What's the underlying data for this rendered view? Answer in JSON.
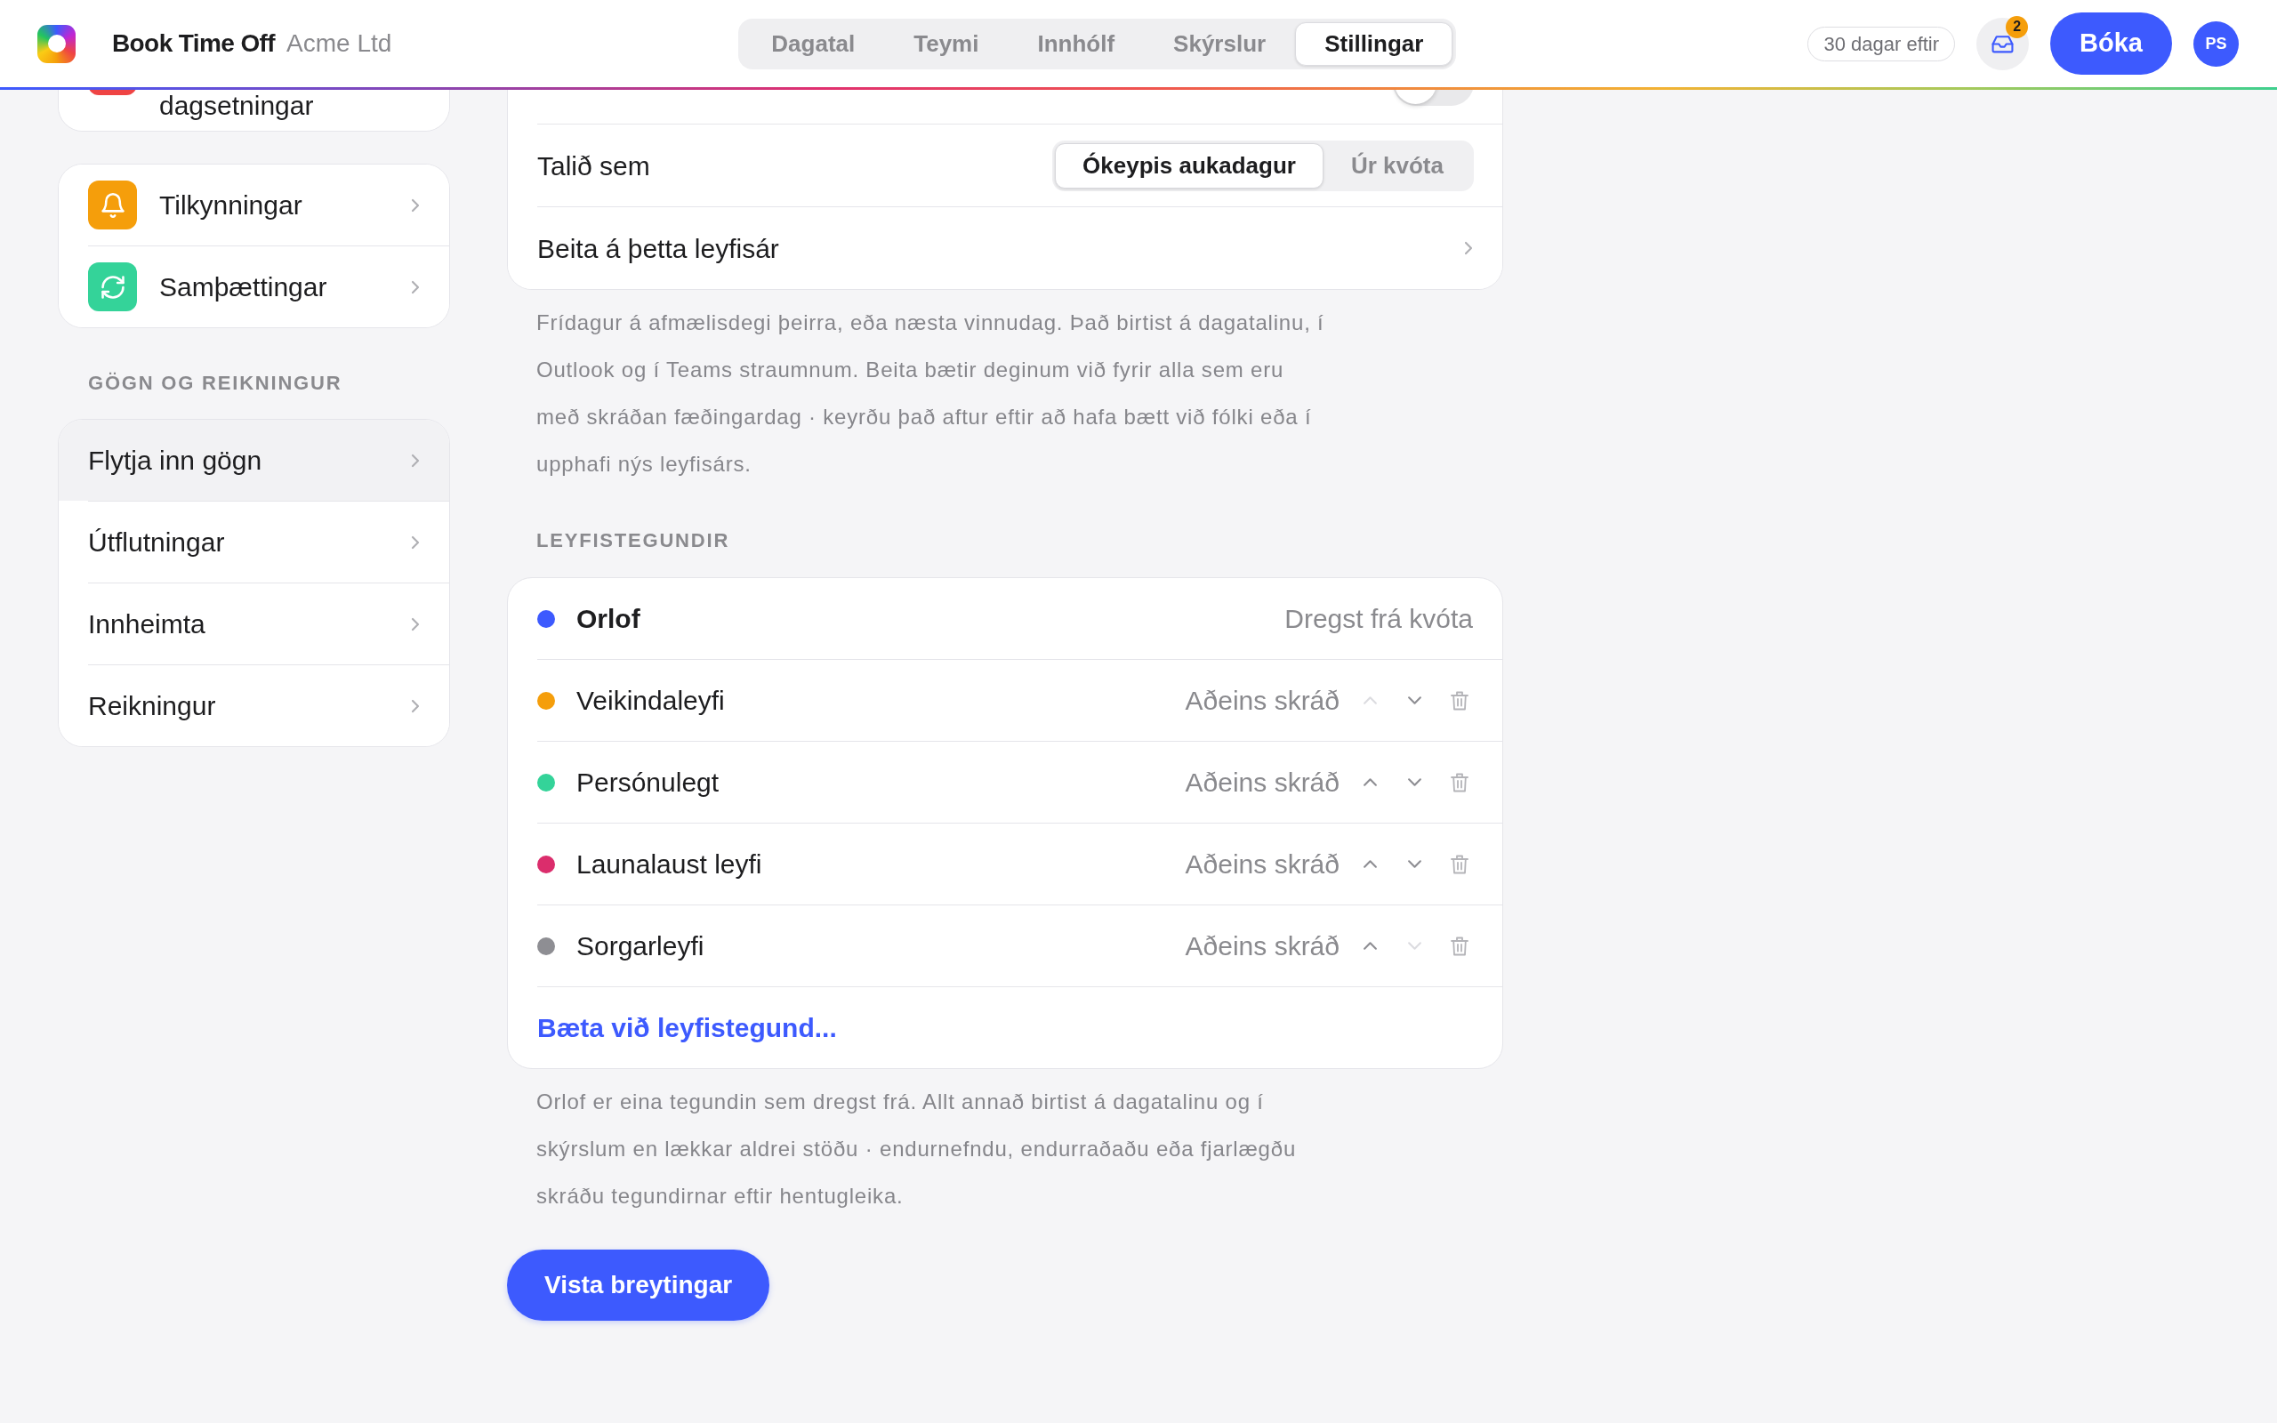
{
  "header": {
    "app_name": "Book Time Off",
    "org": "Acme Ltd",
    "tabs": [
      {
        "label": "Dagatal",
        "selected": false
      },
      {
        "label": "Teymi",
        "selected": false
      },
      {
        "label": "Innhólf",
        "selected": false
      },
      {
        "label": "Skýrslur",
        "selected": false
      },
      {
        "label": "Stillingar",
        "selected": true
      }
    ],
    "days_left": "30 dagar eftir",
    "inbox_badge": "2",
    "book_button": "Bóka",
    "avatar": "PS"
  },
  "sidebar": {
    "groups": [
      {
        "items": [
          {
            "label": "dagsetningar",
            "color": "#ef4444",
            "selected": false
          }
        ]
      },
      {
        "items": [
          {
            "label": "Tilkynningar",
            "color": "#f59e0b",
            "selected": false
          },
          {
            "label": "Samþættingar",
            "color": "#34d399",
            "selected": false
          }
        ]
      },
      {
        "heading": "GÖGN OG REIKNINGUR",
        "items": [
          {
            "label": "Flytja inn gögn",
            "selected": true
          },
          {
            "label": "Útflutningar",
            "selected": false
          },
          {
            "label": "Innheimta",
            "selected": false
          },
          {
            "label": "Reikningur",
            "selected": false
          }
        ]
      }
    ]
  },
  "birthday_leave": {
    "rows": [
      {
        "kind": "toggle",
        "on": false
      },
      {
        "kind": "choice",
        "label": "Talið sem",
        "options": [
          {
            "label": "Ókeypis aukadagur",
            "selected": true
          },
          {
            "label": "Úr kvóta",
            "selected": false
          }
        ]
      },
      {
        "kind": "link",
        "label": "Beita á þetta leyfisár"
      }
    ],
    "note": "Frídagur á afmælisdegi þeirra, eða næsta vinnudag. Það birtist á dagatalinu, í Outlook og í Teams straumnum. Beita bætir deginum við fyrir alla sem eru með skráðan fæðingardag · keyrðu það aftur eftir að hafa bætt við fólki eða í upphafi nýs leyfisárs."
  },
  "leave_types": {
    "heading": "LEYFISTEGUNDIR",
    "items": [
      {
        "kind": "fixed",
        "name": "Orlof",
        "color": "#3d5afe",
        "status": "Dregst frá kvóta"
      },
      {
        "kind": "movable",
        "name": "Veikindaleyfi",
        "color": "#f59e0b",
        "status": "Aðeins skráð",
        "up": {
          "disabled": true
        },
        "down": {
          "disabled": false
        }
      },
      {
        "kind": "movable",
        "name": "Persónulegt",
        "color": "#34d399",
        "status": "Aðeins skráð",
        "up": {
          "disabled": false
        },
        "down": {
          "disabled": false
        }
      },
      {
        "kind": "movable",
        "name": "Launalaust leyfi",
        "color": "#db2d6c",
        "status": "Aðeins skráð",
        "up": {
          "disabled": false
        },
        "down": {
          "disabled": false
        }
      },
      {
        "kind": "movable",
        "name": "Sorgarleyfi",
        "color": "#8e8e93",
        "status": "Aðeins skráð",
        "up": {
          "disabled": false
        },
        "down": {
          "disabled": true
        }
      }
    ],
    "add_link": "Bæta við leyfistegund...",
    "note": "Orlof er eina tegundin sem dregst frá. Allt annað birtist á dagatalinu og í skýrslum en lækkar aldrei stöðu · endurnefndu, endurraðaðu eða fjarlægðu skráðu tegundirnar eftir hentugleika."
  },
  "save_button": "Vista breytingar"
}
